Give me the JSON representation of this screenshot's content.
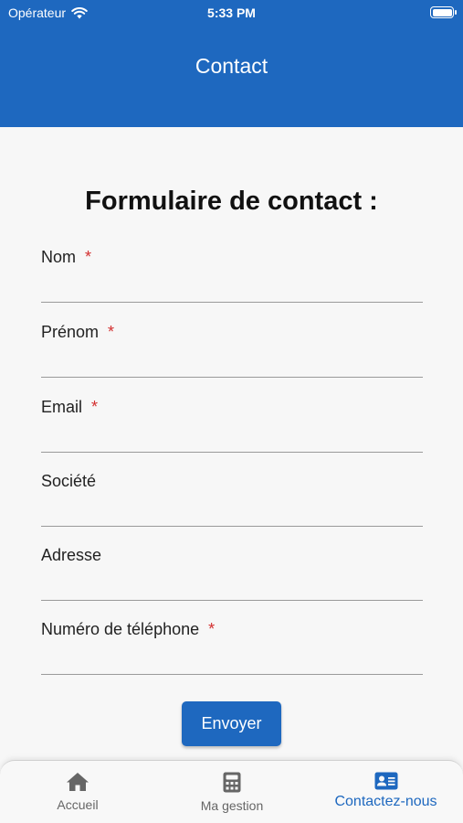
{
  "status_bar": {
    "carrier": "Opérateur",
    "time": "5:33 PM"
  },
  "nav": {
    "title": "Contact"
  },
  "form": {
    "title": "Formulaire de contact :",
    "required_mark": "*",
    "fields": {
      "nom": {
        "label": "Nom",
        "value": ""
      },
      "prenom": {
        "label": "Prénom",
        "value": ""
      },
      "email": {
        "label": "Email",
        "value": ""
      },
      "societe": {
        "label": "Société",
        "value": ""
      },
      "adresse": {
        "label": "Adresse",
        "value": ""
      },
      "telephone": {
        "label": "Numéro de téléphone",
        "value": ""
      }
    },
    "submit_label": "Envoyer"
  },
  "tabbar": {
    "items": [
      {
        "label": "Accueil",
        "icon": "home-icon"
      },
      {
        "label": "Ma gestion",
        "icon": "calculator-icon"
      },
      {
        "label": "Contactez-nous",
        "icon": "contact-card-icon",
        "active": true
      }
    ]
  },
  "colors": {
    "primary": "#1e68bf",
    "required": "#d32f2f",
    "inactive": "#666666"
  }
}
